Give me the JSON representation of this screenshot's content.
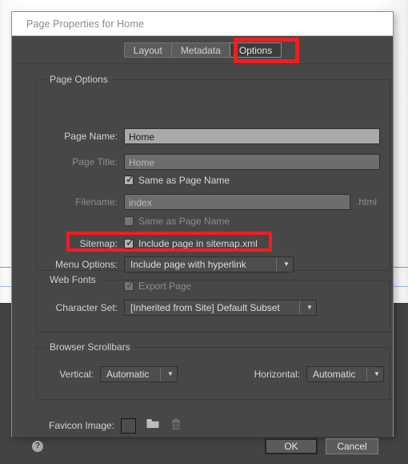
{
  "dialog": {
    "title": "Page Properties for Home",
    "tabs": [
      {
        "label": "Layout",
        "active": false
      },
      {
        "label": "Metadata",
        "active": false
      },
      {
        "label": "Options",
        "active": true
      }
    ],
    "highlight_color": "#f51c20"
  },
  "page_options": {
    "legend": "Page Options",
    "page_name": {
      "label": "Page Name:",
      "value": "Home"
    },
    "page_title": {
      "label": "Page Title:",
      "value": "Home",
      "same_as_page_name_label": "Same as Page Name",
      "same_as_page_name_checked": "✓"
    },
    "filename": {
      "label": "Filename:",
      "value": "index",
      "extension": ".html",
      "same_as_page_name_label": "Same as Page Name"
    },
    "sitemap": {
      "label": "Sitemap:",
      "checkbox_label": "Include page in sitemap.xml",
      "checked": "✓"
    },
    "menu_options": {
      "label": "Menu Options:",
      "value": "Include page with hyperlink"
    },
    "export_page": {
      "label": "Export Page",
      "checked": "✓"
    }
  },
  "web_fonts": {
    "legend": "Web Fonts",
    "character_set": {
      "label": "Character Set:",
      "value": "[Inherited from Site] Default Subset"
    }
  },
  "browser_scrollbars": {
    "legend": "Browser Scrollbars",
    "vertical": {
      "label": "Vertical:",
      "value": "Automatic"
    },
    "horizontal": {
      "label": "Horizontal:",
      "value": "Automatic"
    }
  },
  "favicon": {
    "label": "Favicon Image:",
    "browse_icon": "folder-icon",
    "delete_icon": "trash-icon"
  },
  "footer": {
    "help_glyph": "?",
    "ok_label": "OK",
    "cancel_label": "Cancel"
  }
}
